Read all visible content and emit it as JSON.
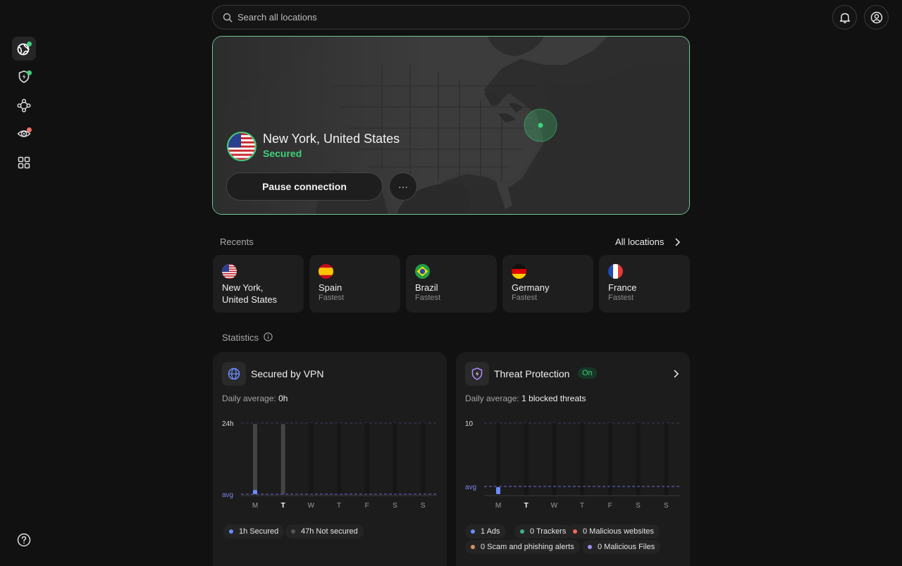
{
  "search": {
    "placeholder": "Search all locations"
  },
  "sidebar": {
    "items": [
      {
        "icon": "globe-icon",
        "active": true,
        "dot": "#41d07e"
      },
      {
        "icon": "shield-bolt-icon",
        "active": false,
        "dot": "#41d07e"
      },
      {
        "icon": "network-nodes-icon",
        "active": false,
        "dot": null
      },
      {
        "icon": "eye-target-icon",
        "active": false,
        "dot": "#f07060"
      },
      {
        "icon": "apps-grid-icon",
        "active": false,
        "dot": null
      }
    ],
    "help_icon": "help-icon"
  },
  "header": {
    "notifications_icon": "bell-icon",
    "account_icon": "user-icon"
  },
  "connection": {
    "location": "New York, United States",
    "status": "Secured",
    "pause_label": "Pause connection",
    "more_label": "···",
    "accent": "#41d07e"
  },
  "recents": {
    "label": "Recents",
    "all_label": "All locations",
    "items": [
      {
        "flag": "us",
        "name": "New York,",
        "name2": "United States",
        "sub": ""
      },
      {
        "flag": "es",
        "name": "Spain",
        "name2": "",
        "sub": "Fastest"
      },
      {
        "flag": "br",
        "name": "Brazil",
        "name2": "",
        "sub": "Fastest"
      },
      {
        "flag": "de",
        "name": "Germany",
        "name2": "",
        "sub": "Fastest"
      },
      {
        "flag": "fr",
        "name": "France",
        "name2": "",
        "sub": "Fastest"
      }
    ]
  },
  "statistics": {
    "label": "Statistics",
    "vpn": {
      "title": "Secured by VPN",
      "daily_label": "Daily average:",
      "daily_value": "0h",
      "y_top": "24h",
      "avg_label": "avg",
      "days": [
        "M",
        "T",
        "W",
        "T",
        "F",
        "S",
        "S"
      ],
      "current_day": 1,
      "legend": [
        {
          "label": "1h Secured",
          "color": "#6b8cff"
        },
        {
          "label": "47h Not secured",
          "color": "#555555"
        }
      ]
    },
    "threat": {
      "title": "Threat Protection",
      "badge": "On",
      "daily_label": "Daily average:",
      "daily_value": "1 blocked threats",
      "y_top": "10",
      "avg_label": "avg",
      "days": [
        "M",
        "T",
        "W",
        "T",
        "F",
        "S",
        "S"
      ],
      "current_day": 1,
      "legend": [
        {
          "label": "1 Ads",
          "color": "#6b8cff"
        },
        {
          "label": "0 Trackers",
          "color": "#3fb28a"
        },
        {
          "label": "0 Malicious websites",
          "color": "#f06a5a"
        },
        {
          "label": "0 Scam and phishing alerts",
          "color": "#d9925a"
        },
        {
          "label": "0 Malicious Files",
          "color": "#9a8cf0"
        }
      ]
    }
  }
}
